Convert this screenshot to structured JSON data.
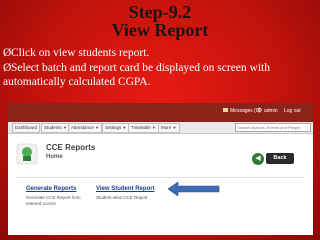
{
  "slide": {
    "title_line1": "Step-9.2",
    "title_line2": "View Report",
    "bullet_mark": "Ø",
    "bullets": [
      "Click on view students report.",
      "Select batch and report card be displayed on screen with automatically calculated CGPA."
    ]
  },
  "screenshot": {
    "topbar": {
      "messages_label": "Messages (0)",
      "admin_label": "admin",
      "logout_label": "Log out"
    },
    "nav": {
      "tabs": [
        "Dashboard",
        "Students",
        "Attendance",
        "Settings",
        "Timetable",
        "More"
      ],
      "search_placeholder": "Search Actions, Events and People"
    },
    "page": {
      "heading": "CCE Reports",
      "subheading": "Home",
      "back_button": "Back"
    },
    "links": [
      {
        "label": "Generate Reports",
        "description": "Generate CCE Report from entered scores"
      },
      {
        "label": "View Student Report",
        "description": "Student-wise CCE Report"
      }
    ]
  },
  "colors": {
    "slide_bg": "#d41a12",
    "title_text": "#1a1414",
    "topbar": "#8c2318",
    "link": "#1a3d8f",
    "arrow": "#3f6bb5"
  }
}
